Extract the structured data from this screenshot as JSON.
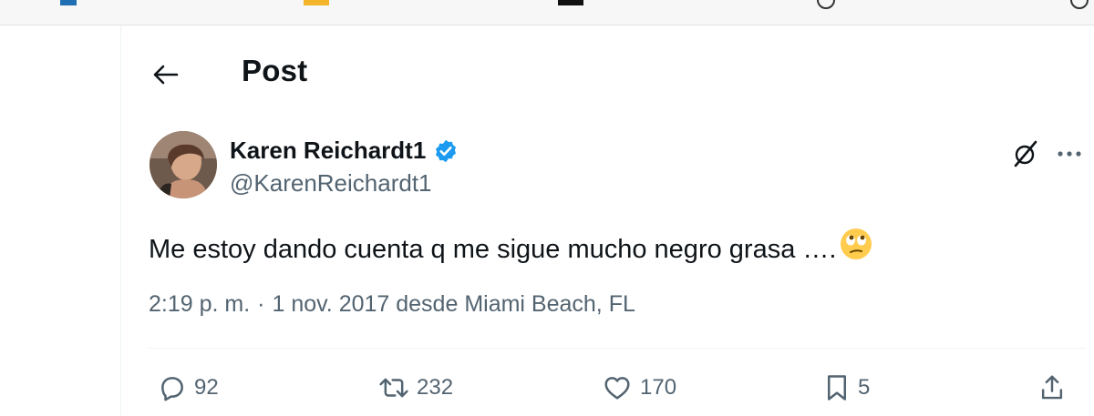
{
  "header": {
    "title": "Post",
    "back_icon": "arrow-left-icon"
  },
  "author": {
    "display_name": "Karen Reichardt1",
    "handle": "@KarenReichardt1",
    "verified": true,
    "verified_color": "#1d9bf0",
    "avatar_icon": "profile-photo"
  },
  "tweet": {
    "text": "Me estoy dando cuenta q me sigue mucho negro grasa ….",
    "emoji": "🙄",
    "time": "2:19 p. m.",
    "separator": "·",
    "date_location": "1 nov. 2017 desde Miami Beach, FL"
  },
  "actions": {
    "replies": "92",
    "reposts": "232",
    "likes": "170",
    "bookmarks": "5"
  },
  "colors": {
    "text_primary": "#0f1419",
    "text_secondary": "#536471",
    "divider": "#eff3f4"
  }
}
